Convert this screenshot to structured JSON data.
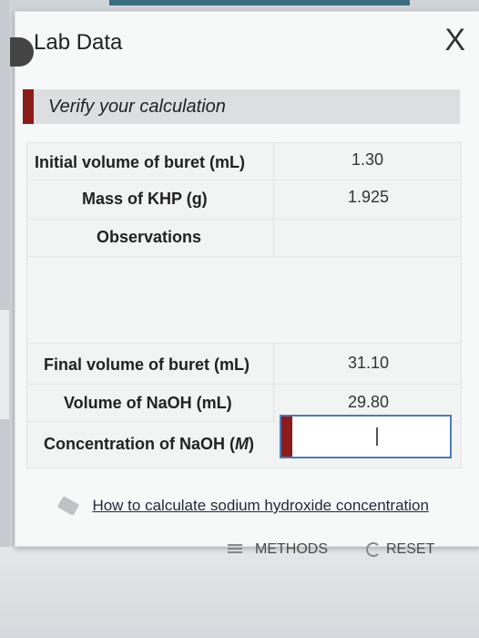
{
  "window": {
    "title": "Lab Data",
    "close_label": "X"
  },
  "banner": {
    "text": "Verify your calculation"
  },
  "table": {
    "initial_volume_label": "Initial volume of buret (mL)",
    "initial_volume_value": "1.30",
    "mass_khp_label": "Mass of KHP (g)",
    "mass_khp_value": "1.925",
    "observations_label": "Observations",
    "final_volume_label": "Final volume of buret (mL)",
    "final_volume_value": "31.10",
    "volume_naoh_label": "Volume of NaOH (mL)",
    "volume_naoh_value": "29.80",
    "concentration_label_prefix": "Concentration of NaOH (",
    "concentration_label_unit": "M",
    "concentration_label_suffix": ")",
    "concentration_value": ""
  },
  "help_link": {
    "text": "How to calculate sodium hydroxide concentration"
  },
  "toolbar": {
    "methods_label": "METHODS",
    "reset_label": "RESET"
  },
  "colors": {
    "accent": "#8b1c1c",
    "input_border": "#4a7bbf"
  }
}
